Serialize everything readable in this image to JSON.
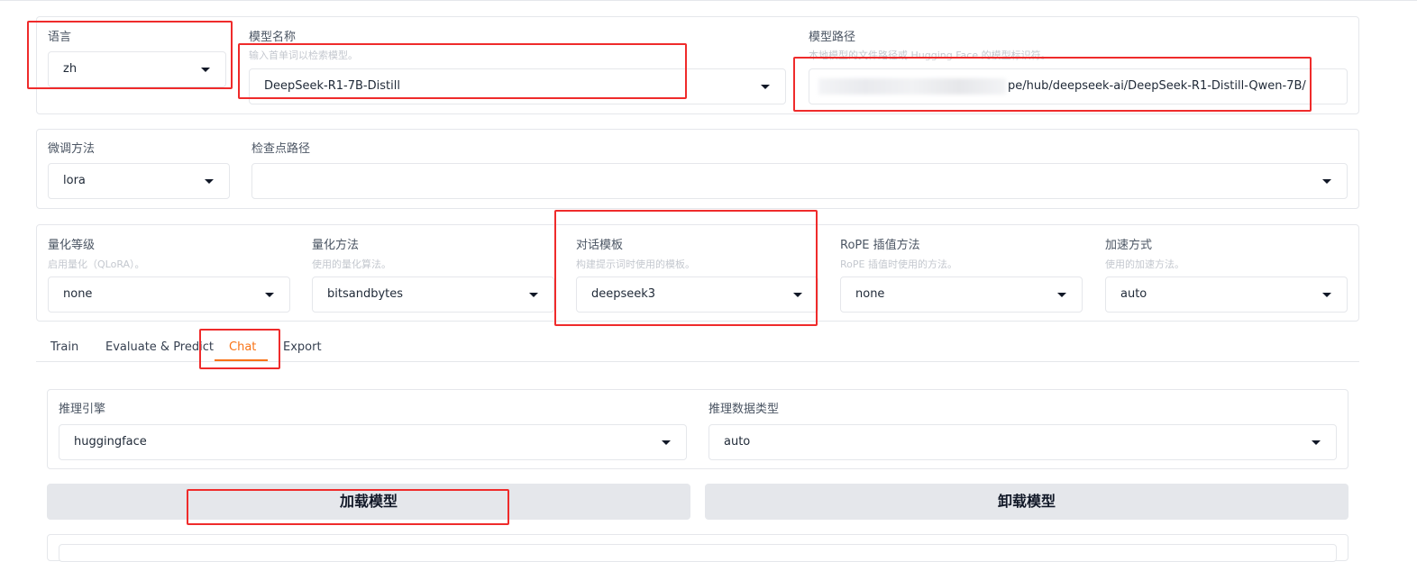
{
  "model_panel": {
    "language": {
      "label": "语言",
      "value": "zh"
    },
    "model_name": {
      "label": "模型名称",
      "hint": "输入首单词以检索模型。",
      "value": "DeepSeek-R1-7B-Distill"
    },
    "model_path": {
      "label": "模型路径",
      "hint": "本地模型的文件路径或 Hugging Face 的模型标识符。",
      "value": "pe/hub/deepseek-ai/DeepSeek-R1-Distill-Qwen-7B/"
    }
  },
  "finetune_panel": {
    "method": {
      "label": "微调方法",
      "value": "lora"
    },
    "checkpoint": {
      "label": "检查点路径",
      "value": ""
    }
  },
  "advanced_panel": {
    "quant_bit": {
      "label": "量化等级",
      "hint": "启用量化（QLoRA）。",
      "value": "none"
    },
    "quant_method": {
      "label": "量化方法",
      "hint": "使用的量化算法。",
      "value": "bitsandbytes"
    },
    "template": {
      "label": "对话模板",
      "hint": "构建提示词时使用的模板。",
      "value": "deepseek3"
    },
    "rope": {
      "label": "RoPE 插值方法",
      "hint": "RoPE 插值时使用的方法。",
      "value": "none"
    },
    "booster": {
      "label": "加速方式",
      "hint": "使用的加速方法。",
      "value": "auto"
    }
  },
  "tabs": [
    {
      "label": "Train"
    },
    {
      "label": "Evaluate & Predict"
    },
    {
      "label": "Chat"
    },
    {
      "label": "Export"
    }
  ],
  "chat_panel": {
    "infer_backend": {
      "label": "推理引擎",
      "value": "huggingface"
    },
    "infer_dtype": {
      "label": "推理数据类型",
      "value": "auto"
    },
    "load_button": "加载模型",
    "unload_button": "卸载模型"
  },
  "colors": {
    "accent": "#f97316",
    "annotation": "#ef2b2b",
    "button_bg": "#e5e7eb"
  }
}
